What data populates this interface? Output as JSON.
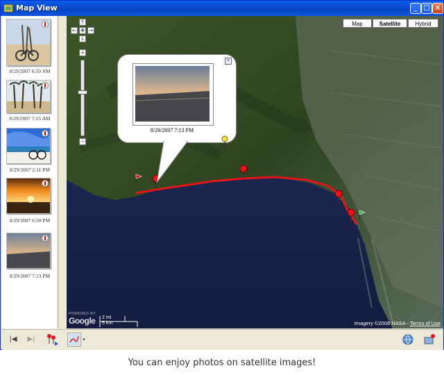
{
  "window": {
    "title": "Map View"
  },
  "photos": [
    {
      "timestamp": "8/29/2007 6:50 AM"
    },
    {
      "timestamp": "8/29/2007 7:15 AM"
    },
    {
      "timestamp": "8/29/2007 2:11 PM"
    },
    {
      "timestamp": "8/29/2007 6:50 PM"
    },
    {
      "timestamp": "8/29/2007 7:13 PM"
    }
  ],
  "map": {
    "map_types": [
      "Map",
      "Satellite",
      "Hybrid"
    ],
    "active_map_type": "Satellite",
    "popup": {
      "timestamp": "8/29/2007 7:13 PM"
    },
    "scale": {
      "miles": "2 mi",
      "km": "5 km"
    },
    "powered_by": "POWERED BY",
    "brand": "Google",
    "attribution": "Imagery ©2008 NASA -",
    "terms": "Terms of Use",
    "track_color": "#e8141c"
  },
  "caption": "You can enjoy photos on satellite images!"
}
